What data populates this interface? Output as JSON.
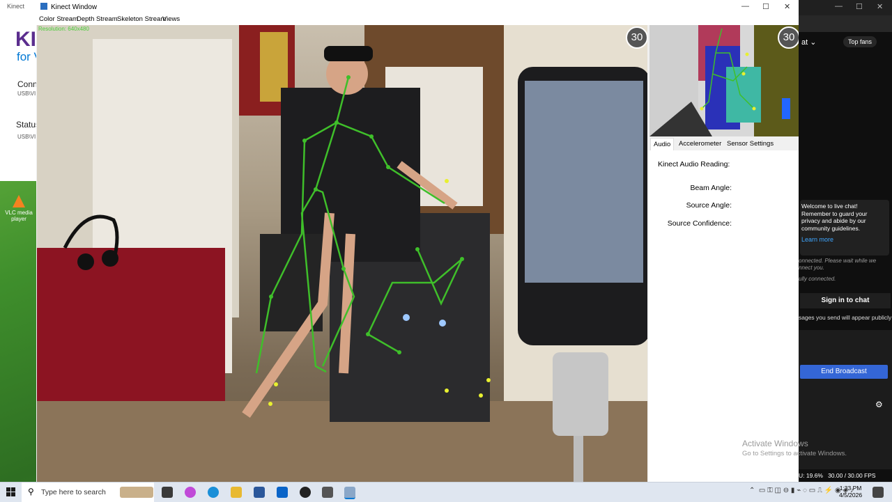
{
  "background_window": {
    "title": "Kinect",
    "logo_line1": "KI",
    "logo_line2": "for V",
    "connected_label": "Conn",
    "connected_value": "USB\\VI",
    "status_label": "Status",
    "status_value": "USB\\VI"
  },
  "desktop_icon": {
    "label": "VLC media player"
  },
  "kinect_window": {
    "title": "Kinect Window",
    "menu": [
      "Color Stream",
      "Depth Stream",
      "Skeleton Stream",
      "Views"
    ],
    "resolution": "Resolution: 640x480",
    "color_fps": "30",
    "depth_fps": "30",
    "tabs": [
      "Audio",
      "Accelerometer",
      "Sensor Settings"
    ],
    "audio": {
      "heading": "Kinect Audio Reading:",
      "beam_angle": "Beam Angle:",
      "source_angle": "Source Angle:",
      "source_confidence": "Source Confidence:"
    }
  },
  "youtube": {
    "top_fans": "Top fans",
    "welcome": "Welcome to live chat! Remember to guard your privacy and abide by our community guidelines.",
    "learn_more": "Learn more",
    "connecting": "onnected. Please wait while we",
    "connecting2": "nnect you.",
    "connected": "ully connected.",
    "sign_in": "Sign in to chat",
    "send_note": "sages you send will appear publicly",
    "end_broadcast": "End Broadcast",
    "cpu": "U: 19.6%",
    "fps": "30.00 / 30.00 FPS"
  },
  "watermark": {
    "line1": "Activate Windows",
    "line2": "Go to Settings to activate Windows."
  },
  "taskbar": {
    "search_placeholder": "Type here to search",
    "time": "1:33 PM",
    "date": "4/5/2026"
  },
  "colors": {
    "skeleton": "#3fbf2a",
    "joint": "#e8f030",
    "accent_blue": "#3466d6"
  }
}
